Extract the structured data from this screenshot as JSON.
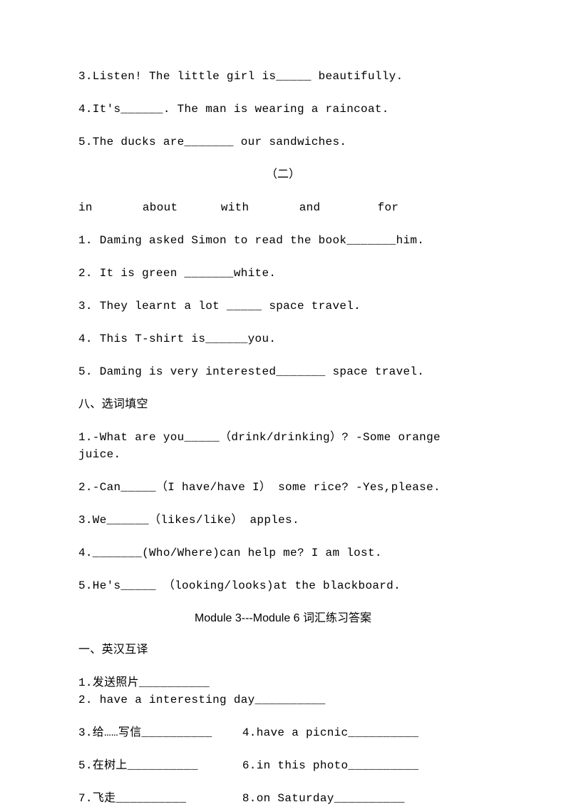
{
  "top": {
    "i3": "3.Listen! The little girl is_____ beautifully.",
    "i4": "4.It's______. The man is wearing a raincoat.",
    "i5": "5.The ducks are_______ our sandwiches."
  },
  "section2_label": "（二）",
  "words": {
    "w1": "in",
    "w2": "about",
    "w3": "with",
    "w4": "and",
    "w5": "for"
  },
  "s2": {
    "i1": "1. Daming asked Simon to read the book_______him.",
    "i2": "2. It is green _______white.",
    "i3": "3. They learnt a lot _____ space travel.",
    "i4": "4. This T-shirt is______you.",
    "i5": "5. Daming is very interested_______ space travel."
  },
  "section8_heading": "八、选词填空",
  "s8": {
    "i1": "1.-What are you_____（drink/drinking）? -Some orange juice.",
    "i2": "2.-Can_____（I have/have I） some rice? -Yes,please.",
    "i3": "3.We______（likes/like） apples.",
    "i4": "4._______(Who/Where)can help me? I am lost.",
    "i5": "5.He's_____ （looking/looks)at the blackboard."
  },
  "answers_title": "Module 3---Module 6 词汇练习答案",
  "sec_yi_heading": "一、英汉互译",
  "vocab": {
    "r1c1": "1.发送照片__________",
    "r1c2": "2. have a interesting day__________",
    "r2c1": "3.给……写信__________",
    "r2c2": "4.have a picnic__________",
    "r3c1": "5.在树上__________",
    "r3c2": "6.in this photo__________",
    "r4c1": "7.飞走__________",
    "r4c2": "8.on Saturday__________"
  }
}
